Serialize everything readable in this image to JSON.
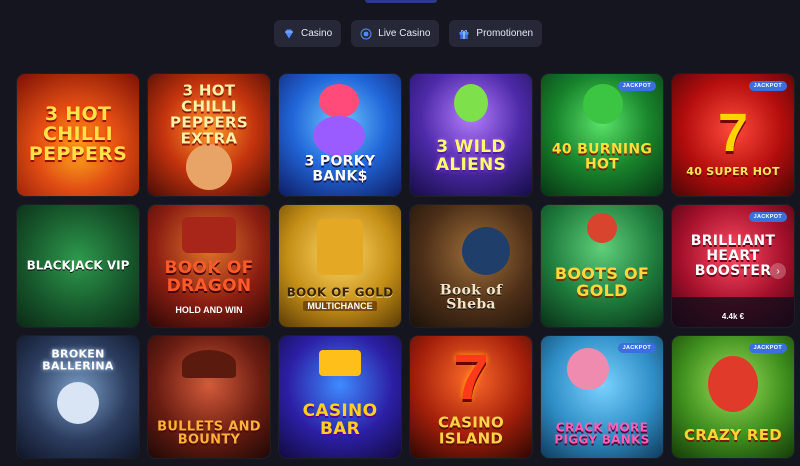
{
  "nav": {
    "tabs": [
      {
        "label": "Casino",
        "icon": "diamond-icon"
      },
      {
        "label": "Live Casino",
        "icon": "live-dot-icon"
      },
      {
        "label": "Promotionen",
        "icon": "gift-icon"
      }
    ]
  },
  "games": [
    {
      "title": "3 HOT CHILLI PEPPERS",
      "jackpot": false
    },
    {
      "title": "3 HOT CHILLI PEPPERS EXTRA",
      "jackpot": false
    },
    {
      "title": "3 PORKY BANK$",
      "jackpot": false
    },
    {
      "title": "3 WILD ALIENS",
      "jackpot": false
    },
    {
      "title": "40 BURNING HOT",
      "jackpot": true
    },
    {
      "title": "40 SUPER HOT",
      "jackpot": true
    },
    {
      "title": "BLACKJACK VIP",
      "jackpot": false
    },
    {
      "title": "BOOK OF DRAGON",
      "subtitle": "HOLD AND WIN",
      "jackpot": false
    },
    {
      "title": "BOOK OF GOLD",
      "subtitle": "MULTICHANCE",
      "jackpot": false
    },
    {
      "title": "Book of Sheba",
      "jackpot": false
    },
    {
      "title": "BOOTS OF GOLD",
      "jackpot": false
    },
    {
      "title": "Brilliant HEART Booster",
      "jackpot": true,
      "players": "4.4k €"
    },
    {
      "title": "BROKEN BALLERINA",
      "jackpot": false
    },
    {
      "title": "BULLETS AND BOUNTY",
      "jackpot": false
    },
    {
      "title": "CASINO BAR",
      "jackpot": false
    },
    {
      "title": "CASINO ISLAND",
      "jackpot": false
    },
    {
      "title": "CRACK MORE PIGGY BANKS",
      "jackpot": true
    },
    {
      "title": "CRAZY RED",
      "jackpot": true
    }
  ],
  "labels": {
    "jackpot_badge": "JACKPOT"
  }
}
